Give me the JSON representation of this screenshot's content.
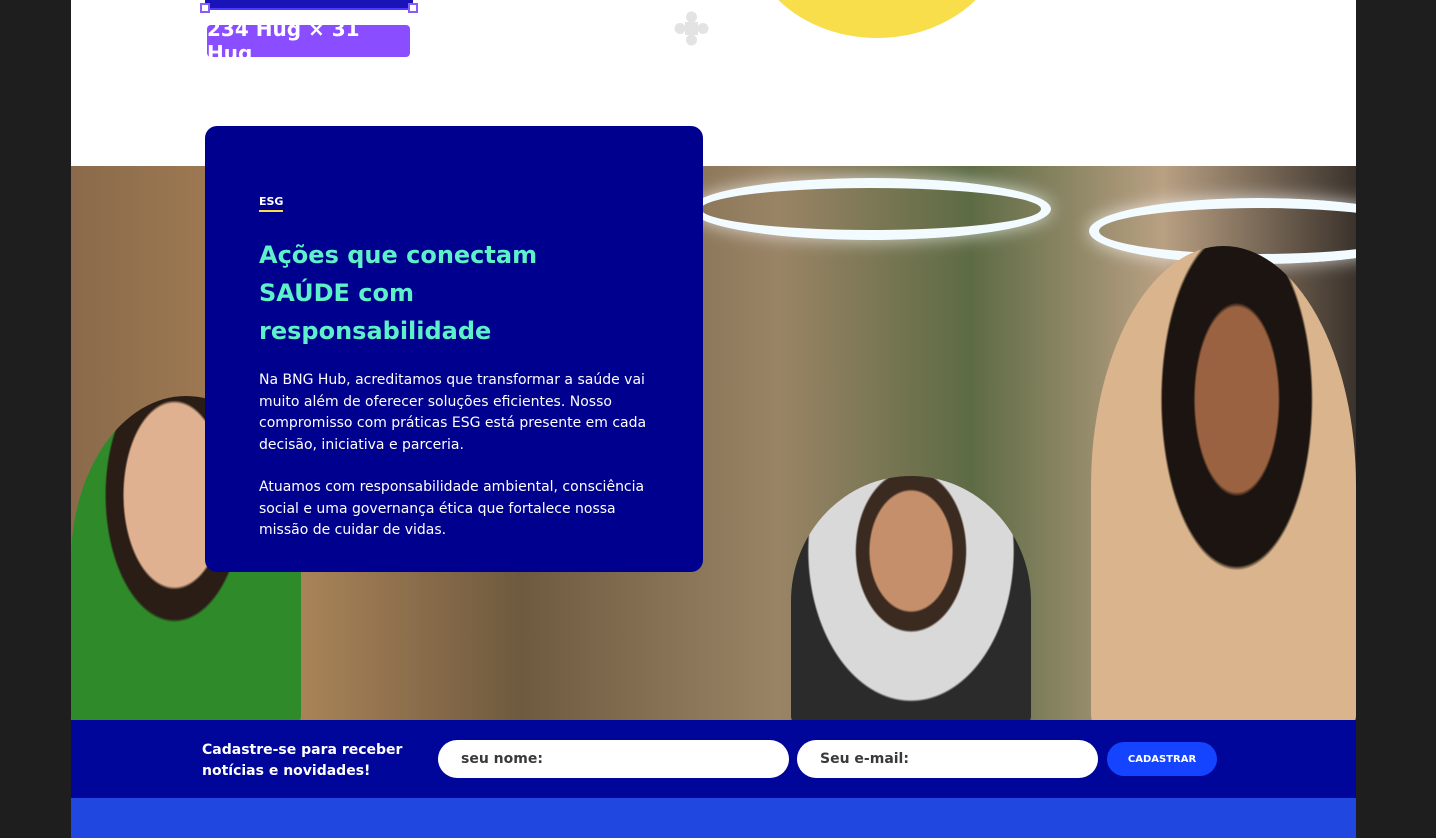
{
  "selection": {
    "size_label": "234 Hug × 31 Hug"
  },
  "icons": {
    "move": "plus-icon"
  },
  "colors": {
    "card_bg": "#00008f",
    "headline": "#5ef0c8",
    "accent_yellow": "#f8de4b",
    "newsletter_bg": "#00069a",
    "button_bg": "#1444ff",
    "selection_badge": "#8a4dff"
  },
  "esg": {
    "tag": "ESG",
    "headline": "Ações que conectam\n SAÚDE com responsabilidade",
    "paragraph1": "Na BNG Hub, acreditamos que transformar a saúde vai muito além de oferecer soluções eficientes. Nosso compromisso com práticas ESG está presente em cada decisão, iniciativa e parceria.",
    "paragraph2": "Atuamos com responsabilidade ambiental, consciência social e uma governança ética que fortalece nossa missão de cuidar de vidas."
  },
  "newsletter": {
    "text": "Cadastre-se para receber notícias e novidades!",
    "name_placeholder": "seu nome:",
    "email_placeholder": "Seu e-mail:",
    "button_label": "CADASTRAR"
  }
}
